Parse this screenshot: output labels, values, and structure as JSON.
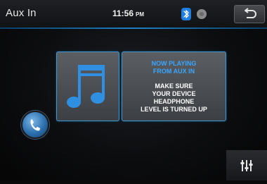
{
  "header": {
    "title": "Aux In",
    "time": "11:56",
    "ampm": "PM"
  },
  "icons": {
    "bluetooth": "bluetooth-icon",
    "disc": "disc-icon",
    "back": "back-arrow-icon",
    "music": "music-note-icon",
    "phone": "phone-icon",
    "equalizer": "equalizer-icon"
  },
  "info": {
    "heading_lines": [
      "NOW PLAYING",
      "FROM AUX IN"
    ],
    "body_lines": [
      "MAKE SURE",
      "YOUR DEVICE",
      "HEADPHONE",
      "LEVEL IS TURNED UP"
    ]
  },
  "colors": {
    "accent": "#3aa6ff",
    "tile_border": "#3a9ad8",
    "bluetooth": "#1e7fe0"
  }
}
